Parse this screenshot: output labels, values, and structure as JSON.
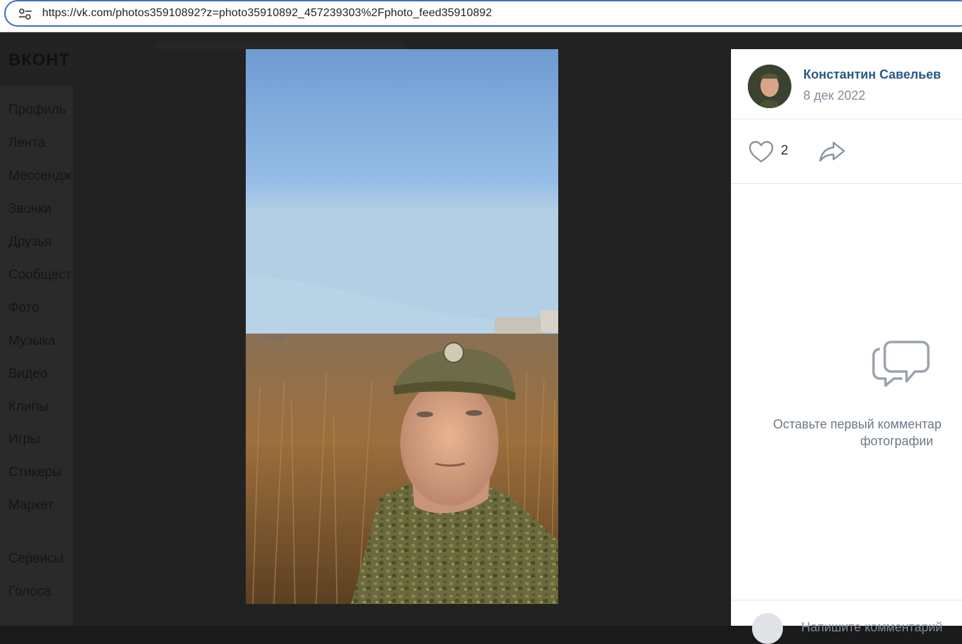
{
  "browser": {
    "url": "https://vk.com/photos35910892?z=photo35910892_457239303%2Fphoto_feed35910892",
    "site_info_icon": "tune-icon"
  },
  "vk": {
    "logo_text": "ВКОНТ",
    "menu": [
      {
        "label": "Профиль"
      },
      {
        "label": "Лента"
      },
      {
        "label": "Мессендж"
      },
      {
        "label": "Звонки"
      },
      {
        "label": "Друзья"
      },
      {
        "label": "Сообщест"
      },
      {
        "label": "Фото"
      },
      {
        "label": "Музыка"
      },
      {
        "label": "Видео"
      },
      {
        "label": "Клипы"
      },
      {
        "label": "Игры"
      },
      {
        "label": "Стикеры"
      },
      {
        "label": "Маркет"
      },
      {
        "label": "Сервисы"
      },
      {
        "label": "Голоса"
      }
    ]
  },
  "viewer": {
    "photo_alt": "selfie-photo",
    "author_name": "Константин Савельев",
    "date": "8 дек 2022",
    "likes_count": "2",
    "empty_comments_line1": "Оставьте первый комментар",
    "empty_comments_line2": "фотографии",
    "comment_placeholder": "Напишите комментарий",
    "colors": {
      "author_link": "#2a5885",
      "muted": "#818c99",
      "overlay": "#222222"
    }
  }
}
